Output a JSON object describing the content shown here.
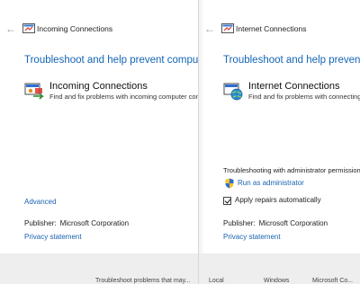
{
  "left_window": {
    "title": "Incoming Connections",
    "heading": "Troubleshoot and help prevent computer problems",
    "item_name": "Incoming Connections",
    "item_description": "Find and fix problems with incoming computer connections and Windows Firewall.",
    "advanced_link": "Advanced",
    "publisher_label": "Publisher:",
    "publisher_value": "Microsoft Corporation",
    "privacy_link": "Privacy statement"
  },
  "right_window": {
    "title": "Internet Connections",
    "heading": "Troubleshoot and help prevent computer problems",
    "item_name": "Internet Connections",
    "item_description": "Find and fix problems with connecting to the Internet or to websites.",
    "admin_note": "Troubleshooting with administrator permissions might find more problems.",
    "run_as_admin_link": "Run as administrator",
    "apply_repairs_label": "Apply repairs automatically",
    "apply_repairs_checked": true,
    "publisher_label": "Publisher:",
    "publisher_value": "Microsoft Corporation",
    "privacy_link": "Privacy statement"
  },
  "background_row": {
    "description": "Troubleshoot problems that may...",
    "location": "Local",
    "category": "Windows",
    "publisher": "Microsoft Co..."
  },
  "colors": {
    "link_blue": "#1a63b0",
    "heading_blue": "#1465b4",
    "footer_gray": "#eeeeee"
  }
}
